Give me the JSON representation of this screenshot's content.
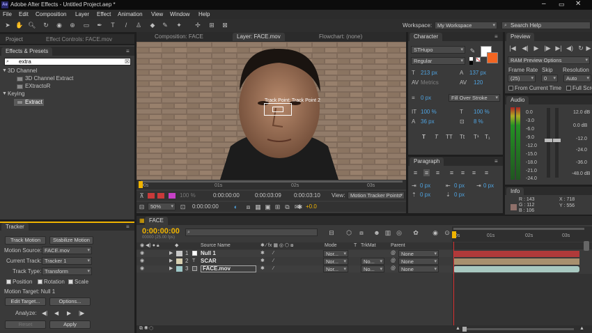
{
  "titlebar": {
    "logo": "Ae",
    "title": "Adobe After Effects - Untitled Project.aep *"
  },
  "menu": [
    "File",
    "Edit",
    "Composition",
    "Layer",
    "Effect",
    "Animation",
    "View",
    "Window",
    "Help"
  ],
  "workspace": {
    "label": "Workspace:",
    "value": "My Workspace",
    "search_placeholder": "Search Help"
  },
  "left_tabs": {
    "project": "Project",
    "effect_controls": "Effect Controls: FACE.mov"
  },
  "effects_presets": {
    "title": "Effects & Presets",
    "search": "extra",
    "tree": [
      {
        "label": "3D Channel",
        "kind": "folder"
      },
      {
        "label": "3D Channel Extract",
        "kind": "effect"
      },
      {
        "label": "EXtractoR",
        "kind": "effect"
      },
      {
        "label": "Keying",
        "kind": "folder"
      },
      {
        "label": "Extract",
        "kind": "effect",
        "selected": true
      }
    ]
  },
  "viewer_tabs": {
    "comp": "Composition: FACE",
    "layer": "Layer: FACE.mov",
    "flowchart": "Flowchart: (none)"
  },
  "viewer": {
    "track_point_label": "Track Point: Track Point 2",
    "ruler_ticks": [
      "00s",
      "01s",
      "02s",
      "03s"
    ],
    "timecodes": [
      "0:00:00:00",
      "0:00:03:09",
      "0:00:03:10"
    ],
    "zoom": "50%",
    "cur_time": "0:00:00:00",
    "exposure": "+0.0",
    "view_label": "View:",
    "view_value": "Motion Tracker Points",
    "res_pct": "100 %"
  },
  "character": {
    "title": "Character",
    "font": "STHupo",
    "style": "Regular",
    "size": "213 px",
    "leading": "137 px",
    "kern": "Metrics",
    "track": "120",
    "stroke_w": "0 px",
    "stroke_type": "Fill Over Stroke",
    "vscale": "100 %",
    "hscale": "100 %",
    "baseline": "36 px",
    "tsume": "8 %",
    "styles": [
      "T",
      "T",
      "TT",
      "Tt",
      "T¹",
      "T₁"
    ]
  },
  "paragraph": {
    "title": "Paragraph",
    "values": [
      "0 px",
      "0 px",
      "0 px",
      "0 px",
      "0 px"
    ]
  },
  "preview": {
    "title": "Preview",
    "ram_options": "RAM Preview Options",
    "frame_rate_label": "Frame Rate",
    "skip_label": "Skip",
    "resolution_label": "Resolution",
    "frame_rate": "(25)",
    "skip": "0",
    "resolution": "Auto",
    "from_current": "From Current Time",
    "full_screen": "Full Scre"
  },
  "audio": {
    "title": "Audio",
    "left_scale": [
      "0.0",
      "-3.0",
      "-6.0",
      "-9.0",
      "-12.0",
      "-15.0",
      "-18.0",
      "-21.0",
      "-24.0"
    ],
    "right_scale": [
      "12.0 dB",
      "0.0 dB",
      "-12.0",
      "-24.0",
      "-36.0",
      "-48.0 dB"
    ]
  },
  "info": {
    "title": "Info",
    "r": "R : 143",
    "g": "G : 112",
    "b": "B : 106",
    "a": "A : 255",
    "x": "X : 718",
    "y": "Y : 556",
    "swatch_color": "#8f706a"
  },
  "tracker": {
    "title": "Tracker",
    "track_motion": "Track Motion",
    "stabilize_motion": "Stabilize Motion",
    "motion_source_label": "Motion Source:",
    "motion_source": "FACE.mov",
    "current_track_label": "Current Track:",
    "current_track": "Tracker 1",
    "track_type_label": "Track Type:",
    "track_type": "Transform",
    "position": "Position",
    "rotation": "Rotation",
    "scale": "Scale",
    "motion_target": "Motion Target: Null 1",
    "edit_target": "Edit Target...",
    "options": "Options...",
    "analyze_label": "Analyze:",
    "reset": "Reset",
    "apply": "Apply"
  },
  "timeline": {
    "tab": "FACE",
    "timecode": "0:00:00:00",
    "fps": "00000 (25.00 fps)",
    "headers": {
      "source": "Source Name",
      "mode": "Mode",
      "t": "T",
      "trkmat": "TrkMat",
      "parent": "Parent"
    },
    "ruler": [
      "0s",
      "01s",
      "02s",
      "03s"
    ],
    "layers": [
      {
        "num": "1",
        "name": "Null 1",
        "label": "#c8c8c8",
        "mode": "Nor...",
        "trkmat": "",
        "parent": "None",
        "bar": "#b03a3a"
      },
      {
        "num": "2",
        "name": "SCAR",
        "label": "#d8d0b0",
        "mode": "Nor...",
        "trkmat": "No...",
        "parent": "None",
        "bar": "#a8906e"
      },
      {
        "num": "3",
        "name": "FACE.mov",
        "label": "#9ec8c8",
        "mode": "Nor...",
        "trkmat": "No...",
        "parent": "None",
        "bar": "#a8c8c0"
      }
    ]
  },
  "colors": {
    "accent": "#f0b400",
    "blue": "#4fa3e0",
    "bg": "#3a3a3a",
    "orange": "#f26522"
  }
}
